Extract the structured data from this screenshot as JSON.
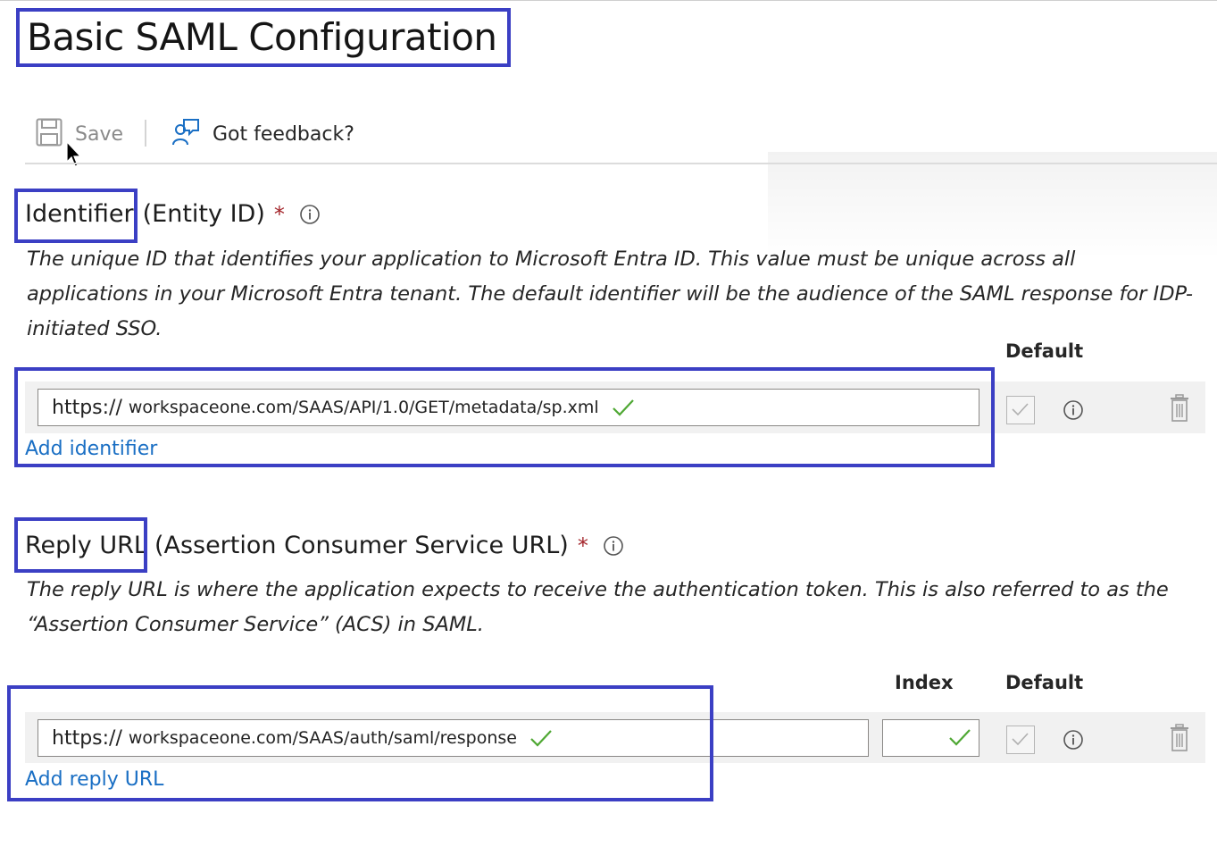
{
  "page": {
    "title": "Basic SAML Configuration"
  },
  "toolbar": {
    "save_label": "Save",
    "feedback_label": "Got feedback?"
  },
  "identifier": {
    "title_main": "Identifier",
    "title_paren": "(Entity ID)",
    "required_mark": "*",
    "description": "The unique ID that identifies your application to Microsoft Entra ID. This value must be unique across all applications in your Microsoft Entra tenant. The default identifier will be the audience of the SAML response for IDP-initiated SSO.",
    "default_header": "Default",
    "row": {
      "scheme": "https://",
      "rest": "workspaceone.com/SAAS/API/1.0/GET/metadata/sp.xml",
      "valid": true,
      "default_checked": false
    },
    "add_link": "Add identifier"
  },
  "reply_url": {
    "title_main": "Reply URL",
    "title_paren": "(Assertion Consumer Service URL)",
    "required_mark": "*",
    "description": "The reply URL is where the application expects to receive the authentication token. This is also referred to as the “Assertion Consumer Service” (ACS) in SAML.",
    "index_header": "Index",
    "default_header": "Default",
    "row": {
      "scheme": "https://",
      "rest": "workspaceone.com/SAAS/auth/saml/response",
      "index_value": "",
      "valid": true,
      "default_checked": false
    },
    "add_link": "Add reply URL"
  },
  "colors": {
    "annotation_border": "#3b3fc4",
    "link": "#1a6fc4",
    "required": "#a4262c",
    "valid_check": "#4fa834"
  }
}
